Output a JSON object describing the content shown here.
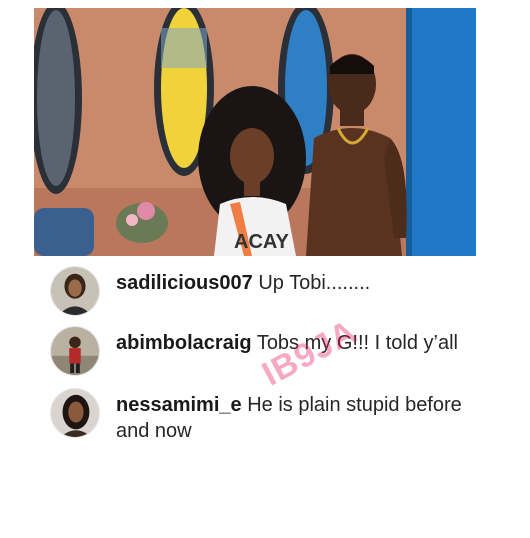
{
  "comments": [
    {
      "username": "sadilicious007",
      "text": "Up Tobi........"
    },
    {
      "username": "abimbolacraig",
      "text": "Tobs my G!!! I told y’all"
    },
    {
      "username": "nessamimi_e",
      "text": "He is plain stupid before and now"
    }
  ],
  "watermark": "IB9JA",
  "colors": {
    "photo_wall": "#c9876a",
    "mirror_frame": "#2a2f38",
    "mirror_yellow": "#f0d23a",
    "mirror_blue": "#2f7fc4",
    "door_blue": "#1f78c8",
    "watermark_pink": "#e91e63"
  }
}
